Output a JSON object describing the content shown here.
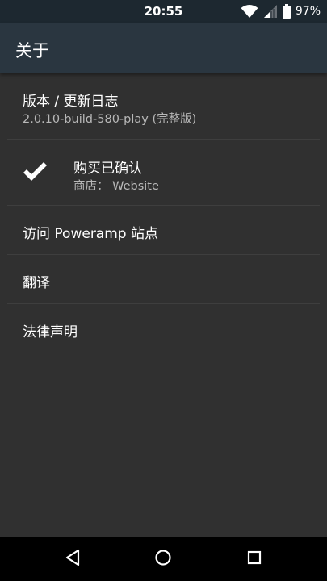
{
  "status_bar": {
    "time": "20:55",
    "battery": "97%",
    "icons": [
      "wifi-icon",
      "signal-icon",
      "battery-icon"
    ]
  },
  "app_bar": {
    "title": "关于"
  },
  "items": [
    {
      "title": "版本 / 更新日志",
      "subtitle": "2.0.10-build-580-play (完整版)"
    },
    {
      "title": "购买已确认",
      "subtitle": "商店： Website",
      "icon": "check-icon"
    },
    {
      "title": "访问 Poweramp 站点"
    },
    {
      "title": "翻译"
    },
    {
      "title": "法律声明"
    }
  ],
  "nav_bar": {
    "icons": [
      "back-icon",
      "home-icon",
      "recents-icon"
    ]
  },
  "colors": {
    "background": "#303030",
    "app_bar": "#2a3640",
    "status_bar": "#1d2830",
    "divider": "#3e3e3e"
  }
}
